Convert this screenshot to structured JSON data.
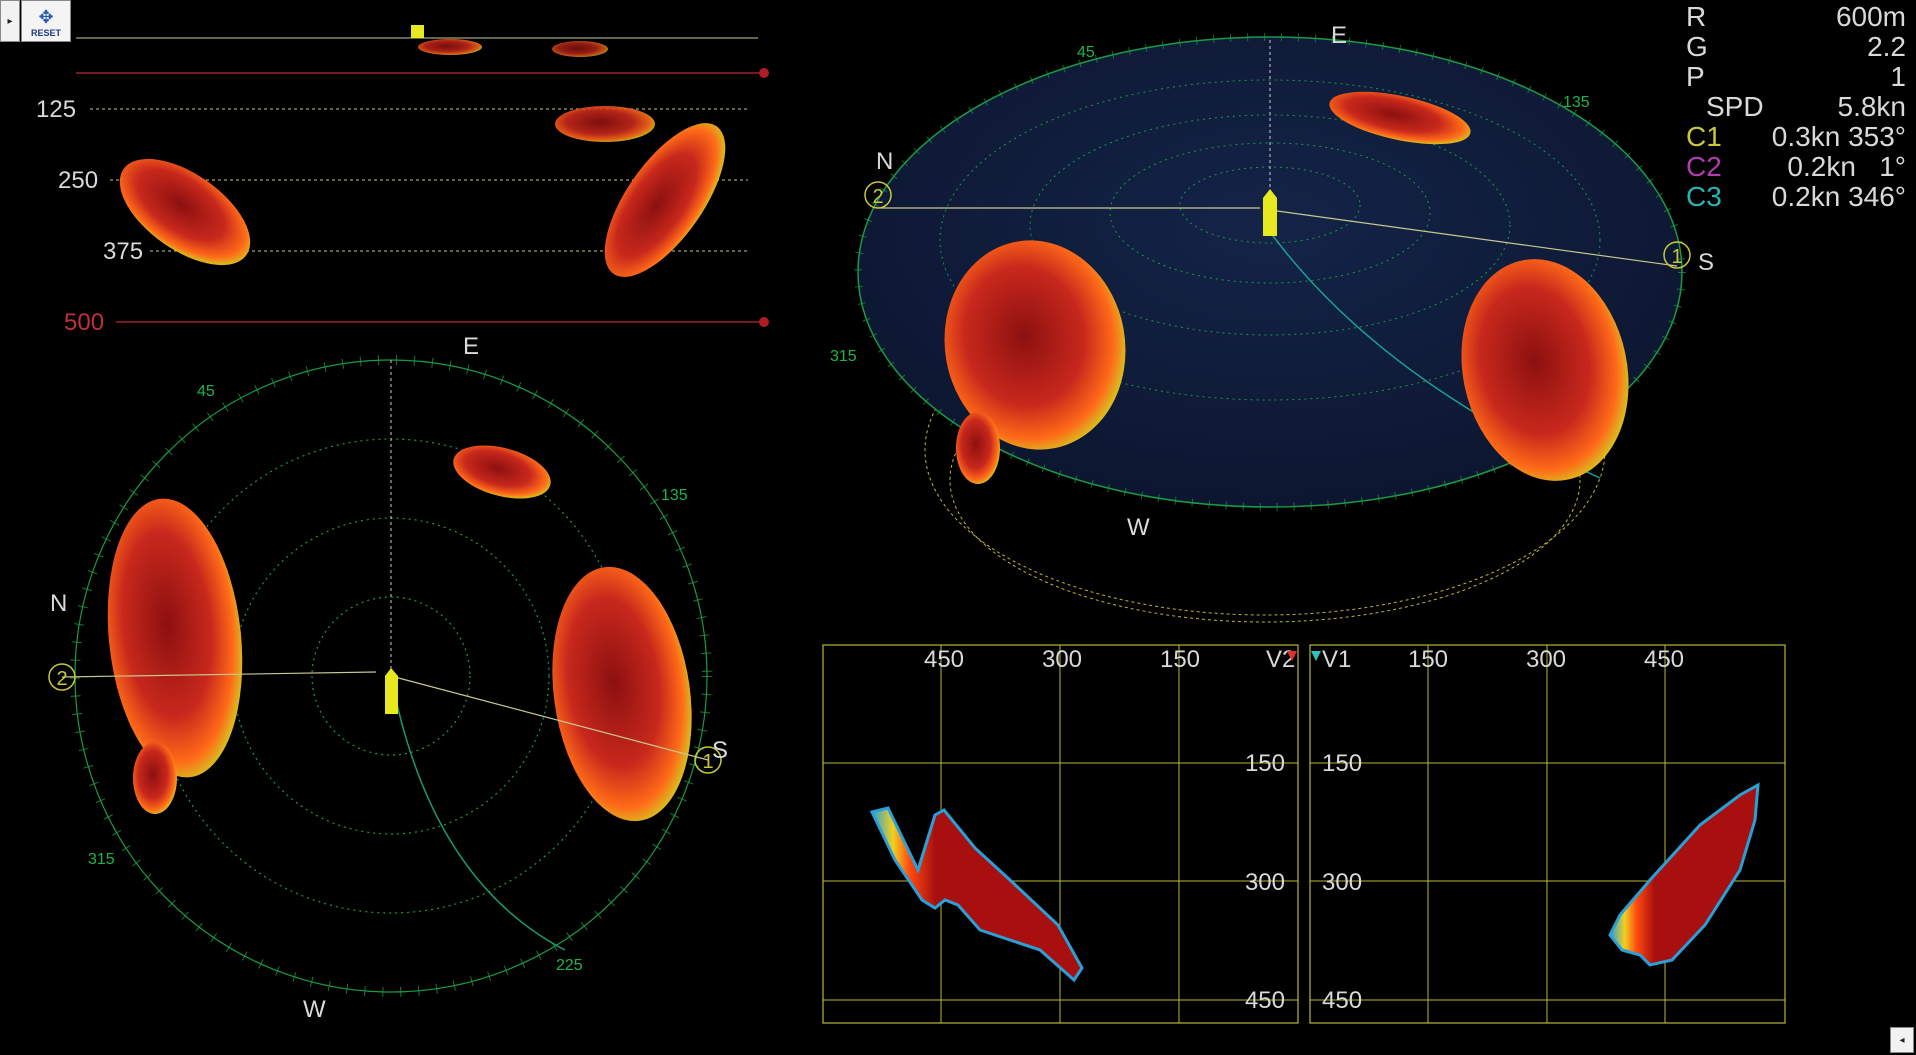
{
  "controls": {
    "menu_glyph": "▸",
    "reset_label": "RESET",
    "reset_glyph": "✥",
    "collapse_glyph": "◂"
  },
  "info": {
    "rows": [
      {
        "key": "R",
        "value": "600m",
        "color": "#d9d9d9"
      },
      {
        "key": "G",
        "value": "2.2",
        "color": "#d9d9d9"
      },
      {
        "key": "P",
        "value": "1",
        "color": "#d9d9d9"
      },
      {
        "key": "SPD",
        "value": "5.8kn",
        "color": "#d9d9d9"
      },
      {
        "key": "C1",
        "value": "0.3kn 353°",
        "color": "#c8c83a"
      },
      {
        "key": "C2",
        "value": "0.2kn   1°",
        "color": "#b03cb0"
      },
      {
        "key": "C3",
        "value": "0.2kn 346°",
        "color": "#28b4b4"
      }
    ]
  },
  "depth_profile": {
    "labels": [
      "125",
      "250",
      "375",
      "500"
    ]
  },
  "plan_view": {
    "compass": {
      "E": "E",
      "N": "N",
      "W": "W",
      "S": "S"
    },
    "bearings": {
      "b45": "45",
      "b135": "135",
      "b225": "225",
      "b315": "315"
    },
    "markers": {
      "m1": "1",
      "m2": "2"
    }
  },
  "view_3d": {
    "compass": {
      "E": "E",
      "N": "N",
      "W": "W",
      "S": "S"
    },
    "bearings": {
      "b45": "45",
      "b135": "135",
      "b315": "315"
    },
    "markers": {
      "m1": "1",
      "m2": "2"
    }
  },
  "section_v2": {
    "label": "V2",
    "x_ticks": [
      "450",
      "300",
      "150"
    ],
    "y_ticks": [
      "150",
      "300",
      "450"
    ]
  },
  "section_v1": {
    "label": "V1",
    "x_ticks": [
      "150",
      "300",
      "450"
    ],
    "y_ticks": [
      "150",
      "300",
      "450"
    ]
  },
  "colors": {
    "grid_green": "#1a9a44",
    "grid_yellow": "#b8b830",
    "echo_core": "#a01818",
    "echo_edge": "#ff6a18",
    "limit_red": "#a0202a",
    "ship": "#e8e820",
    "dome": "#101c3a"
  }
}
